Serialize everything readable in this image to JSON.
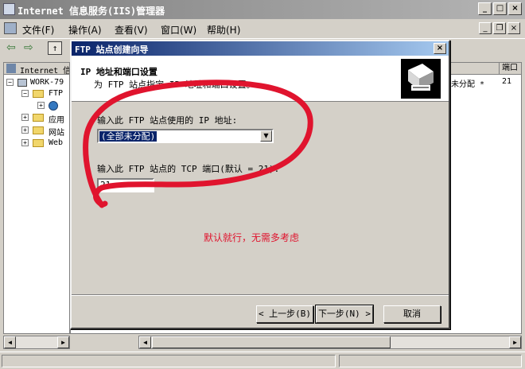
{
  "window": {
    "title": "Internet 信息服务(IIS)管理器"
  },
  "menu": {
    "items": [
      "文件(F)",
      "操作(A)",
      "查看(V)",
      "窗口(W)",
      "帮助(H)"
    ]
  },
  "tree": {
    "header": "Internet 信",
    "nodes": [
      "WORK-79",
      "FTP",
      "应用",
      "网站",
      "Web"
    ]
  },
  "list": {
    "col2_header": "端口",
    "cell1": "未分配 *",
    "cell2": "21"
  },
  "dialog": {
    "title": "FTP 站点创建向导",
    "header_title": "IP 地址和端口设置",
    "header_subtitle": "为 FTP 站点指定 IP 地址和端口设置。",
    "ip_label": "输入此 FTP 站点使用的 IP 地址:",
    "ip_value": "(全部未分配)",
    "port_label": "输入此 FTP 站点的 TCP 端口(默认 = 21):",
    "port_value": "21",
    "annotation": "默认就行，无需多考虑",
    "back_button": "< 上一步(B)",
    "next_button": "下一步(N) >",
    "cancel_button": "取消"
  },
  "colors": {
    "annotation": "#e0142e",
    "title_active": "#0a246a"
  }
}
